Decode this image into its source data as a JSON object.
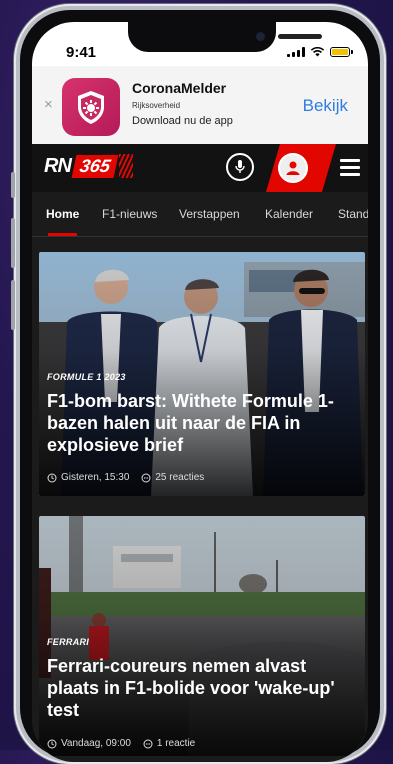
{
  "status_bar": {
    "time": "9:41"
  },
  "banner": {
    "title": "CoronaMelder",
    "publisher": "Rijksoverheid",
    "subtitle": "Download nu de app",
    "action": "Bekijk",
    "close": "×"
  },
  "header": {
    "logo_rn": "RN",
    "logo_365": "365"
  },
  "nav": {
    "tabs": [
      {
        "label": "Home"
      },
      {
        "label": "F1-nieuws"
      },
      {
        "label": "Verstappen"
      },
      {
        "label": "Kalender"
      },
      {
        "label": "Stand"
      }
    ]
  },
  "articles": [
    {
      "tag": "FORMULE 1 2023",
      "headline": "F1-bom barst: Withete Formule 1-bazen halen uit naar de FIA in explosieve brief",
      "time": "Gisteren, 15:30",
      "comments": "25 reacties"
    },
    {
      "tag": "FERRARI",
      "headline": "Ferrari-coureurs nemen alvast plaats in F1-bolide voor 'wake-up' test",
      "time": "Vandaag, 09:00",
      "comments": "1 reactie"
    }
  ],
  "colors": {
    "accent": "#e10600",
    "link": "#2f7de1",
    "app_icon": "#c72a60"
  }
}
